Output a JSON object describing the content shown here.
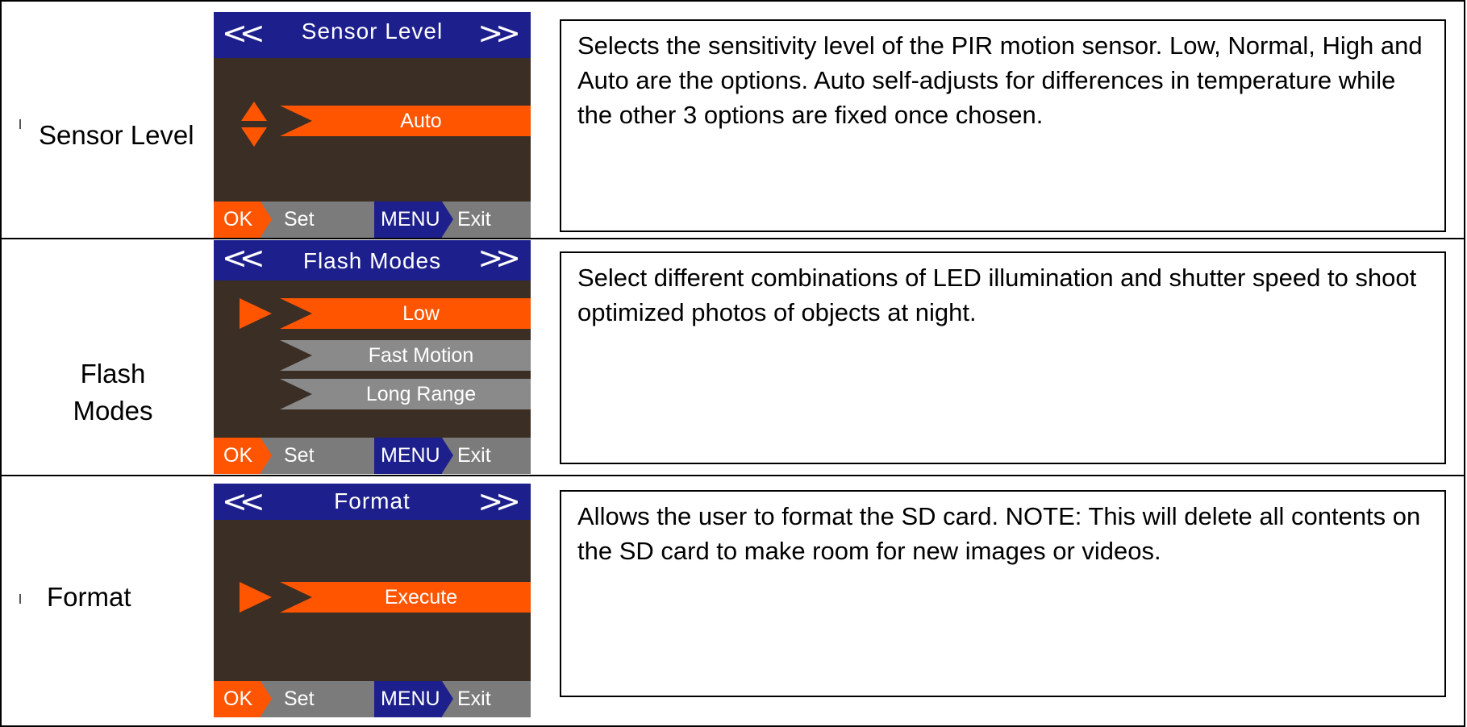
{
  "rows": [
    {
      "label": "Sensor Level",
      "screen": {
        "left_nav": "<<",
        "title": "Sensor Level",
        "right_nav": ">>",
        "options": [
          {
            "label": "Auto",
            "selected": true
          }
        ],
        "selector": "up-down-arrows",
        "footer": {
          "ok": "OK",
          "set": "Set",
          "menu": "MENU",
          "exit": "Exit"
        }
      },
      "description": "Selects the sensitivity level of the PIR motion sensor.  Low, Normal, High and Auto are the options.  Auto self-adjusts for differences in temperature while the other 3 options are fixed once chosen."
    },
    {
      "label": "Flash Modes",
      "screen": {
        "left_nav": "<<",
        "title": "Flash Modes",
        "right_nav": ">>",
        "options": [
          {
            "label": "Low",
            "selected": true
          },
          {
            "label": "Fast Motion",
            "selected": false
          },
          {
            "label": "Long Range",
            "selected": false
          }
        ],
        "selector": "right-pointer",
        "footer": {
          "ok": "OK",
          "set": "Set",
          "menu": "MENU",
          "exit": "Exit"
        }
      },
      "description": "Select different combinations of LED illumination and shutter speed to shoot optimized photos of objects at night."
    },
    {
      "label": "Format",
      "screen": {
        "left_nav": "<<",
        "title": "Format",
        "right_nav": ">>",
        "options": [
          {
            "label": "Execute",
            "selected": true
          }
        ],
        "selector": "right-pointer",
        "footer": {
          "ok": "OK",
          "set": "Set",
          "menu": "MENU",
          "exit": "Exit"
        }
      },
      "description": "Allows the user to format the SD card.  NOTE:  This will delete all contents on the SD card to make room for new images or videos."
    }
  ],
  "colors": {
    "header_blue": "#1d1f8c",
    "accent_orange": "#ff5500",
    "screen_bg": "#3a2e25",
    "inactive_grey": "#8a8a8a"
  }
}
